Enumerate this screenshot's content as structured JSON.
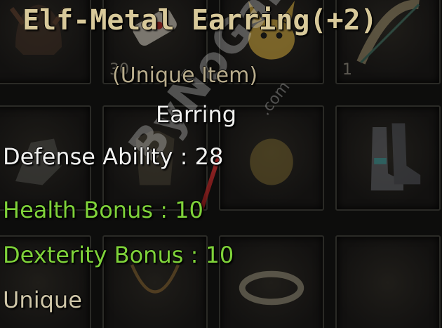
{
  "tooltip": {
    "title": "Elf-Metal Earring(+2)",
    "subtitle": "(Unique Item)",
    "item_type": "Earring",
    "defense": "Defense Ability : 28",
    "health_bonus": "Health Bonus : 10",
    "dexterity_bonus": "Dexterity Bonus : 10",
    "rarity": "Unique"
  },
  "inventory": {
    "slots": [
      {
        "qty": ""
      },
      {
        "qty": "30"
      },
      {
        "qty": ""
      },
      {
        "qty": "1"
      },
      {
        "qty": ""
      },
      {
        "qty": ""
      },
      {
        "qty": ""
      },
      {
        "qty": ""
      },
      {
        "qty": ""
      },
      {
        "qty": ""
      },
      {
        "qty": ""
      },
      {
        "qty": ""
      }
    ]
  },
  "watermark": {
    "text": "ByNoGame",
    "suffix": ".com"
  },
  "colors": {
    "title": "#d8c99a",
    "bonus_green": "#7fd23a",
    "white": "#f1f1ef"
  }
}
